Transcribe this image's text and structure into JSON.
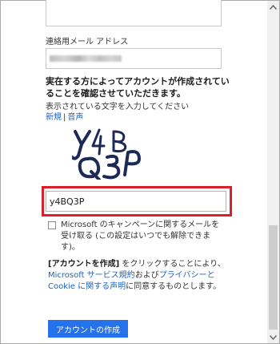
{
  "form": {
    "email_label": "連絡用メール アドレス",
    "human_note": "実在する方によってアカウントが作成されていることを確認させていただきます。",
    "captcha_instruction": "表示されている文字を入力してください",
    "captcha_new_link": "新規",
    "captcha_separator": "|",
    "captcha_audio_link": "音声",
    "captcha_value": "y4BQ3P",
    "optin_text": "Microsoft のキャンペーンに関するメールを受け取る (この設定はいつでも解除できます)。",
    "optin_checked": false,
    "legal_prefix_bold": "[アカウントを作成]",
    "legal_part1": " をクリックすることにより、",
    "legal_link1": "Microsoft サービス規約",
    "legal_part2": "および",
    "legal_link2": "プライバシーと Cookie に関する声明",
    "legal_part3": "に同意するものとします。",
    "create_button": "アカウントの作成"
  },
  "colors": {
    "link": "#1a63c6",
    "button": "#2672ec",
    "highlight": "#d9202b",
    "captcha_ink": "#1d2a57"
  },
  "icons": {
    "scroll_up": "chevron-up-icon",
    "scroll_down": "chevron-down-icon"
  }
}
